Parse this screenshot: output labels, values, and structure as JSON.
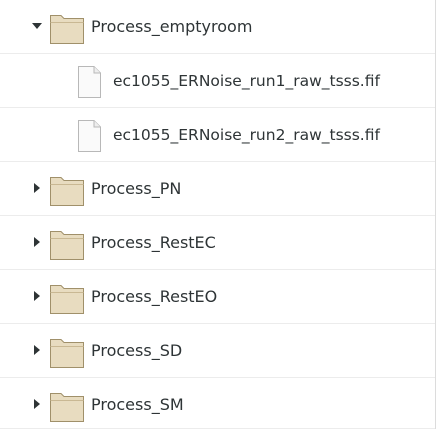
{
  "tree": {
    "items": [
      {
        "label": "Process_emptyroom",
        "type": "folder",
        "expanded": true,
        "expander_icon": "triangle-down-icon",
        "icon": "folder-icon"
      },
      {
        "label": "ec1055_ERNoise_run1_raw_tsss.fif",
        "type": "file",
        "icon": "file-icon"
      },
      {
        "label": "ec1055_ERNoise_run2_raw_tsss.fif",
        "type": "file",
        "icon": "file-icon"
      },
      {
        "label": "Process_PN",
        "type": "folder",
        "expanded": false,
        "expander_icon": "triangle-right-icon",
        "icon": "folder-icon"
      },
      {
        "label": "Process_RestEC",
        "type": "folder",
        "expanded": false,
        "expander_icon": "triangle-right-icon",
        "icon": "folder-icon"
      },
      {
        "label": "Process_RestEO",
        "type": "folder",
        "expanded": false,
        "expander_icon": "triangle-right-icon",
        "icon": "folder-icon"
      },
      {
        "label": "Process_SD",
        "type": "folder",
        "expanded": false,
        "expander_icon": "triangle-right-icon",
        "icon": "folder-icon"
      },
      {
        "label": "Process_SM",
        "type": "folder",
        "expanded": false,
        "expander_icon": "triangle-right-icon",
        "icon": "folder-icon"
      }
    ]
  },
  "colors": {
    "folder_fill": "#e8dcc0",
    "folder_stroke": "#a0906a",
    "text": "#2e3436",
    "expander": "#2e3436"
  }
}
